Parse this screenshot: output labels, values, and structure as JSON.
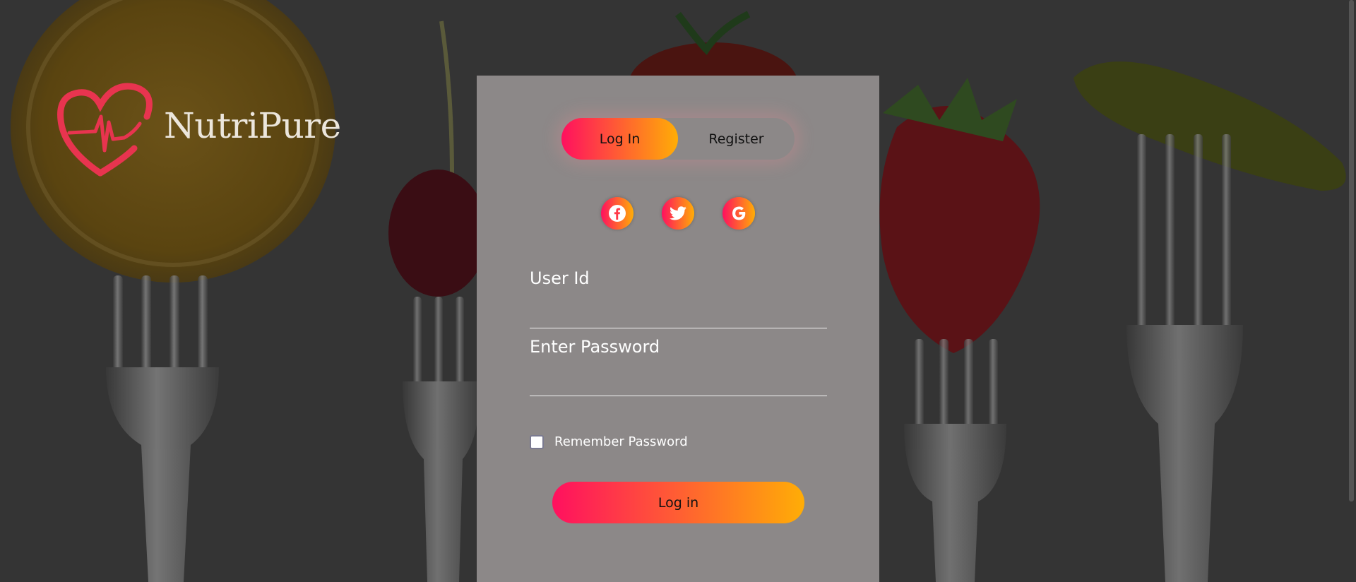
{
  "brand": {
    "name": "NutriPure",
    "logo_icon": "heart-heartbeat-icon",
    "color": "#e8344f"
  },
  "tabs": {
    "login_label": "Log In",
    "register_label": "Register"
  },
  "social": [
    {
      "icon": "facebook-icon",
      "glyph": "f"
    },
    {
      "icon": "twitter-icon",
      "glyph": "bird"
    },
    {
      "icon": "google-icon",
      "glyph": "G"
    }
  ],
  "form": {
    "user_label": "User Id",
    "user_value": "",
    "password_label": "Enter Password",
    "password_value": "",
    "remember_label": "Remember Password",
    "remember_checked": false,
    "submit_label": "Log in"
  },
  "colors": {
    "gradient_start": "#ff105f",
    "gradient_end": "#ffad06",
    "panel": "#8c8888",
    "background": "#343434"
  }
}
